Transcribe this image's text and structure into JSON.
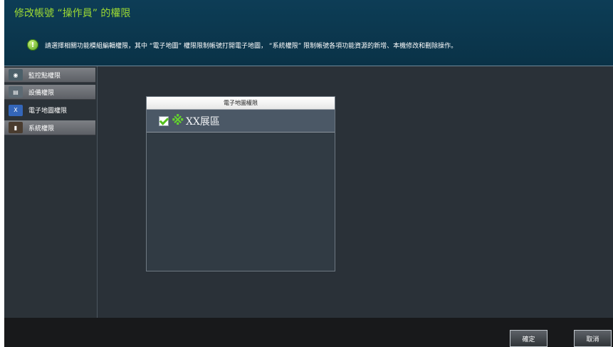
{
  "header": {
    "title": "修改帳號 “操作員” 的權限",
    "notice": "請選擇相關功能模組編輯權限，其中 “電子地圖” 權限限制帳號打開電子地圖， “系統權限” 限制帳號各項功能資源的新增、本機修改和刪除操作。"
  },
  "sidebar": {
    "items": [
      {
        "label": "監控點權限",
        "icon": "camera-icon"
      },
      {
        "label": "設備權限",
        "icon": "device-icon"
      },
      {
        "label": "電子地圖權限",
        "icon": "map-icon"
      },
      {
        "label": "系統權限",
        "icon": "system-icon"
      }
    ]
  },
  "main": {
    "panel_title": "電子地圖權限",
    "items": [
      {
        "label": "XX展區",
        "checked": true
      }
    ]
  },
  "footer": {
    "confirm_label": "確定",
    "cancel_label": "取消"
  },
  "colors": {
    "accent_green": "#9dda33",
    "header_blue": "#0d3d56",
    "dark_bg": "#2a3138"
  }
}
